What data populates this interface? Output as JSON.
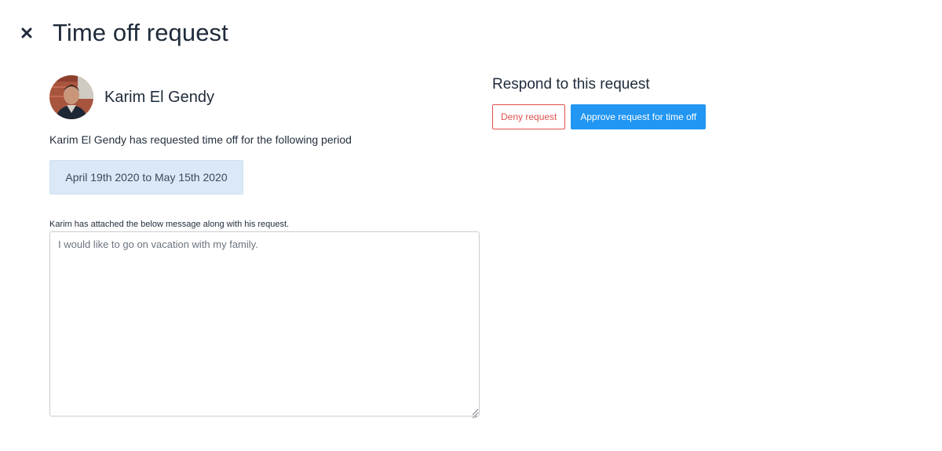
{
  "header": {
    "title": "Time off request",
    "close_icon": "close-icon"
  },
  "requester": {
    "name": "Karim El Gendy",
    "avatar_icon": "user-avatar-photo",
    "request_text": "Karim El Gendy has requested time off for the following period",
    "period": "April 19th 2020 to May 15th 2020"
  },
  "message": {
    "label": "Karim has attached the below message along with his request.",
    "value": "I would like to go on vacation with my family."
  },
  "respond": {
    "title": "Respond to this request",
    "deny_label": "Deny request",
    "approve_label": "Approve request for time off"
  },
  "colors": {
    "deny": "#e0524f",
    "approve": "#2196f3",
    "period_bg": "#dbe9f7",
    "text": "#1f2b3a"
  }
}
